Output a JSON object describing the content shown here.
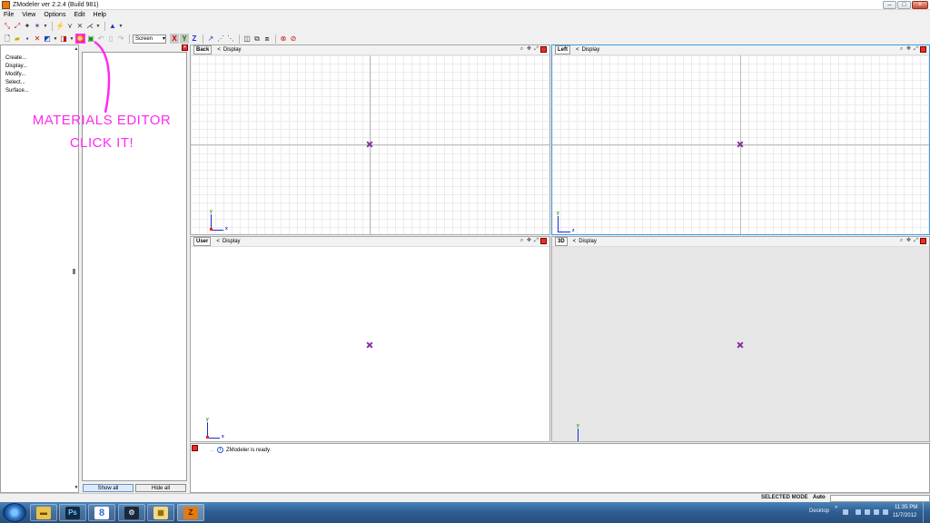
{
  "window": {
    "title": "ZModeler ver 2.2.4 (Build 981)",
    "minimize_glyph": "–",
    "maximize_glyph": "□",
    "close_glyph": "×"
  },
  "menu": [
    "File",
    "View",
    "Options",
    "Edit",
    "Help"
  ],
  "toolbar": {
    "screen_select_value": "Screen",
    "dropdown_glyph": "▾",
    "axis_x": "X",
    "axis_y": "Y",
    "axis_z": "Z"
  },
  "command_panel": {
    "items": [
      "Create...",
      "Display...",
      "Modify...",
      "Select...",
      "Surface..."
    ],
    "scroll_up": "▲",
    "scroll_down": "▼"
  },
  "objects_panel": {
    "close_glyph": "×",
    "show_all_label": "Show all",
    "hide_all_label": "Hide all"
  },
  "annotation": {
    "text": "MATERIALS EDITOR\nCLICK IT!",
    "color": "#ff2bf0"
  },
  "viewports": [
    {
      "name": "Back",
      "display_arrow": "<",
      "display_label": "Display",
      "gizmo_top": "y",
      "gizmo_right": "x",
      "bottom_axis_label": "x"
    },
    {
      "name": "Left",
      "display_arrow": "<",
      "display_label": "Display",
      "gizmo_top": "y",
      "gizmo_right": "z"
    },
    {
      "name": "User",
      "display_arrow": "<",
      "display_label": "Display",
      "gizmo_top": "y",
      "gizmo_right": "x",
      "bottom_axis_label": "x"
    },
    {
      "name": "3D",
      "display_arrow": "<",
      "display_label": "Display",
      "gizmo_top": "y",
      "gizmo_right": "x"
    }
  ],
  "viewport_tools": [
    "search-icon",
    "pan-icon",
    "maximize-icon",
    "close-icon"
  ],
  "message_panel": {
    "info_glyph": "i",
    "message": "ZModeler is ready."
  },
  "statusbar": {
    "mode": "SELECTED MODE",
    "auto": "Auto"
  },
  "taskbar": {
    "apps": [
      "explorer-icon",
      "photoshop-icon",
      "google-icon",
      "steam-icon",
      "file-manager-icon",
      "zmodeler-icon"
    ],
    "ps_glyph": "Ps",
    "google_glyph": "8",
    "zmodeler_glyph": "Z",
    "desktop_label": "Desktop",
    "time": "11:35 PM",
    "date": "11/7/2012"
  }
}
